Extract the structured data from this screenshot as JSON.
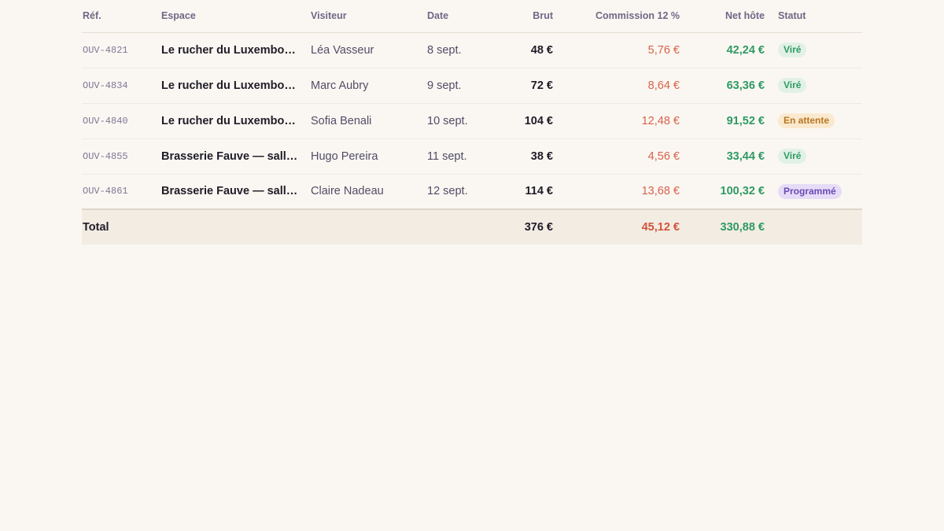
{
  "table": {
    "headers": {
      "ref": "Réf.",
      "espace": "Espace",
      "visiteur": "Visiteur",
      "date": "Date",
      "brut": "Brut",
      "commission": "Commission 12 %",
      "net": "Net hôte",
      "statut": "Statut"
    },
    "rows": [
      {
        "ref": "OUV-4821",
        "espace": "Le rucher du Luxembourg",
        "visiteur": "Léa Vasseur",
        "date": "8 sept.",
        "brut": "48 €",
        "commission": "5,76 €",
        "net": "42,24 €",
        "statut": "Viré",
        "statut_kind": "vire"
      },
      {
        "ref": "OUV-4834",
        "espace": "Le rucher du Luxembourg",
        "visiteur": "Marc Aubry",
        "date": "9 sept.",
        "brut": "72 €",
        "commission": "8,64 €",
        "net": "63,36 €",
        "statut": "Viré",
        "statut_kind": "vire"
      },
      {
        "ref": "OUV-4840",
        "espace": "Le rucher du Luxembourg",
        "visiteur": "Sofia Benali",
        "date": "10 sept.",
        "brut": "104 €",
        "commission": "12,48 €",
        "net": "91,52 €",
        "statut": "En attente",
        "statut_kind": "attente"
      },
      {
        "ref": "OUV-4855",
        "espace": "Brasserie Fauve — salle...",
        "visiteur": "Hugo Pereira",
        "date": "11 sept.",
        "brut": "38 €",
        "commission": "4,56 €",
        "net": "33,44 €",
        "statut": "Viré",
        "statut_kind": "vire"
      },
      {
        "ref": "OUV-4861",
        "espace": "Brasserie Fauve — salle...",
        "visiteur": "Claire Nadeau",
        "date": "12 sept.",
        "brut": "114 €",
        "commission": "13,68 €",
        "net": "100,32 €",
        "statut": "Programmé",
        "statut_kind": "programme"
      }
    ],
    "total": {
      "label": "Total",
      "brut": "376 €",
      "commission": "45,12 €",
      "net": "330,88 €"
    }
  },
  "colors": {
    "background": "#faf7f2",
    "commission": "#d9614a",
    "net": "#2f9a64",
    "status_vire": "#2f9a64",
    "status_attente": "#b8761f",
    "status_programme": "#6a4bb5"
  }
}
